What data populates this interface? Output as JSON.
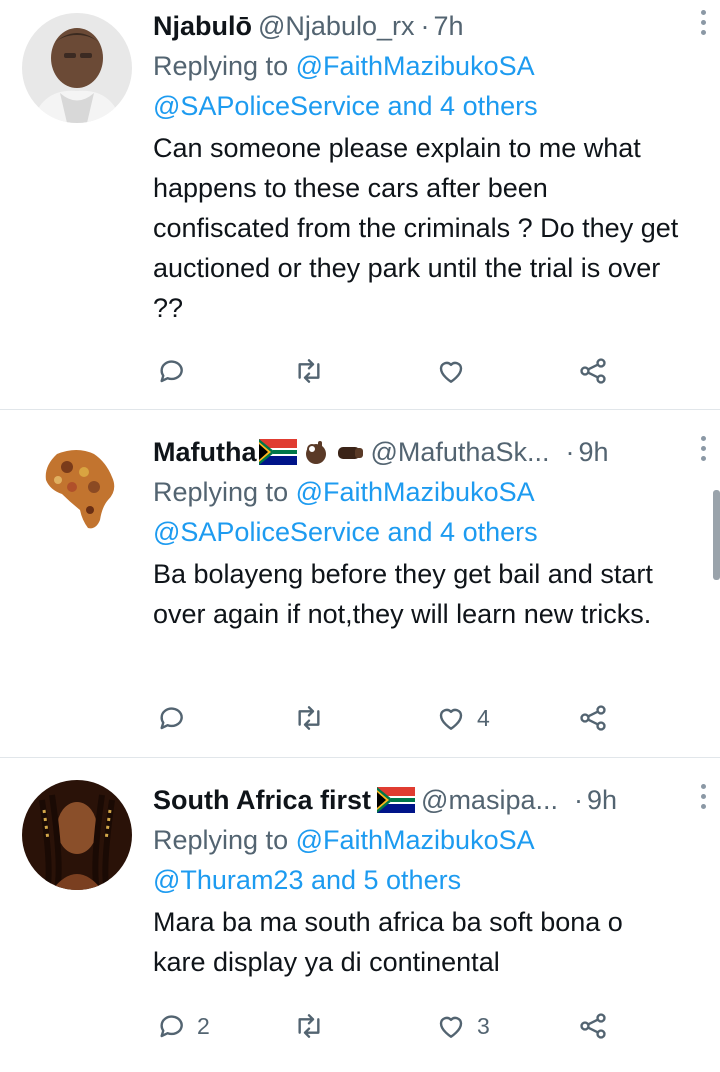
{
  "tweets": [
    {
      "name": "Njabulō",
      "handle": "@Njabulo_rx",
      "separator": "·",
      "time": "7h",
      "replying_prefix": "Replying to ",
      "replying_to": "@FaithMazibukoSA",
      "replying_line2": "@SAPoliceService and 4 others",
      "text": "Can someone please explain to me what happens to these cars after been confiscated from the criminals ? Do they get auctioned or they park until the trial is over ??",
      "reply_count": "",
      "retweet_count": "",
      "like_count": ""
    },
    {
      "name": "Mafutha",
      "handle": "@MafuthaSk...",
      "separator": "·",
      "time": "9h",
      "replying_prefix": "Replying to ",
      "replying_to": "@FaithMazibukoSA",
      "replying_line2": "@SAPoliceService and 4 others",
      "text": "Ba bolayeng before they get bail and start over again if not,they will learn new tricks.",
      "reply_count": "",
      "retweet_count": "",
      "like_count": "4"
    },
    {
      "name": "South Africa first",
      "handle": "@masipa...",
      "separator": "·",
      "time": "9h",
      "replying_prefix": "Replying to ",
      "replying_to": "@FaithMazibukoSA",
      "replying_line2": "@Thuram23 and 5 others",
      "text": "Mara ba ma south africa ba soft bona o kare display ya di continental",
      "reply_count": "2",
      "retweet_count": "",
      "like_count": "3"
    }
  ],
  "icons": {
    "reply": "reply-icon",
    "retweet": "retweet-icon",
    "like": "heart-icon",
    "share": "share-icon",
    "more": "more-vertical-icon",
    "flag": "south-africa-flag-icon"
  },
  "colors": {
    "link": "#1d9bf0",
    "secondary_text": "#536471",
    "icon": "#536471"
  }
}
